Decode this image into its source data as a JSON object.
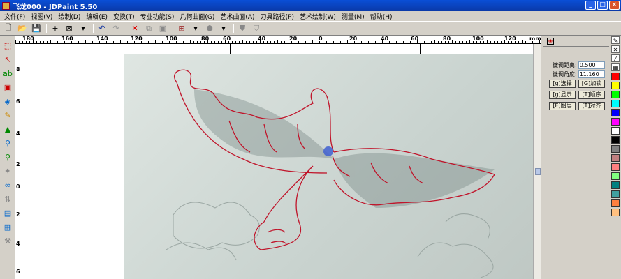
{
  "window": {
    "title": "飞龙000 - JDPaint 5.50",
    "buttons": [
      "_",
      "□",
      "×"
    ]
  },
  "menu": [
    "文件(F)",
    "视图(V)",
    "绘制(D)",
    "编辑(E)",
    "变换(T)",
    "专业功能(S)",
    "几何曲面(G)",
    "艺术曲面(A)",
    "刀具路径(P)",
    "艺术绘制(W)",
    "测量(M)",
    "帮助(H)"
  ],
  "ruler": {
    "top_labels": [
      "180",
      "160",
      "140",
      "120",
      "100",
      "80",
      "60",
      "40",
      "20",
      "0",
      "20",
      "40",
      "60",
      "80",
      "100",
      "120"
    ],
    "unit": "mm",
    "left_labels": [
      "8",
      "6",
      "4",
      "2",
      "0",
      "2",
      "4",
      "6"
    ]
  },
  "panel": {
    "micro_distance_label": "微调距离:",
    "micro_distance_value": "0.500",
    "micro_angle_label": "微调角度:",
    "micro_angle_value": "11.160",
    "buttons": [
      "[g]选择",
      "[G]加锁",
      "[g]显示",
      "[T]顺序",
      "[E]图层",
      "[T]对齐"
    ]
  },
  "colors": {
    "titlebar": "#0a39a8",
    "palette": [
      "#ff0000",
      "#ffff00",
      "#00ff00",
      "#00ffff",
      "#0000ff",
      "#ff00ff",
      "#ffffff",
      "#000000",
      "#808080",
      "#c08080",
      "#ff8080",
      "#80ff80",
      "#008080",
      "#40a0a0",
      "#ff8040",
      "#ffc080"
    ]
  }
}
